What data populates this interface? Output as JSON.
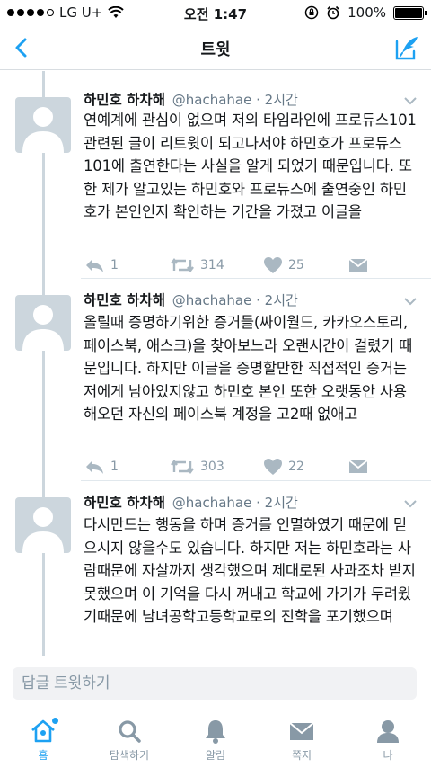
{
  "status": {
    "carrier": "LG U+",
    "time": "오전 1:47",
    "battery": "100%",
    "battery_level": 1.0,
    "signal_bars_filled": 4
  },
  "nav": {
    "title": "트윗"
  },
  "tweets": [
    {
      "name": "하민호 하차해",
      "handle": "@hachahae",
      "time": "· 2시간",
      "text": "연예계에 관심이 없으며 저의 타임라인에 프로듀스101 관련된 글이 리트윗이 되고나서야 하민호가 프로듀스101에 출연한다는 사실을 알게 되었기 때문입니다. 또한 제가 알고있는 하민호와 프로듀스에 출연중인 하민호가 본인인지 확인하는 기간을 가졌고 이글을",
      "replies": "1",
      "retweets": "314",
      "likes": "25"
    },
    {
      "name": "하민호 하차해",
      "handle": "@hachahae",
      "time": "· 2시간",
      "text": "올릴때 증명하기위한 증거들(싸이월드, 카카오스토리, 페이스북, 애스크)을 찾아보느라 오랜시간이 걸렸기 때문입니다. 하지만 이글을 증명할만한 직접적인 증거는 저에게 남아있지않고 하민호 본인 또한 오랫동안 사용해오던 자신의 페이스북 계정을 고2때 없애고",
      "replies": "1",
      "retweets": "303",
      "likes": "22"
    },
    {
      "name": "하민호 하차해",
      "handle": "@hachahae",
      "time": "· 2시간",
      "text": "다시만드는 행동을 하며 증거를 인멸하였기 때문에 믿으시지 않을수도 있습니다. 하지만 저는 하민호라는 사람때문에 자살까지 생각했으며 제대로된 사과조차 받지 못했으며 이 기억을 다시 꺼내고 학교에 가기가 두려웠기때문에 남녀공학고등학교로의 진학을 포기했으며"
    }
  ],
  "reply": {
    "placeholder": "답글 트윗하기"
  },
  "tabs": [
    {
      "label": "홈",
      "icon": "home-icon"
    },
    {
      "label": "탐색하기",
      "icon": "search-icon"
    },
    {
      "label": "알림",
      "icon": "bell-icon"
    },
    {
      "label": "쪽지",
      "icon": "envelope-icon"
    },
    {
      "label": "나",
      "icon": "person-icon"
    }
  ],
  "colors": {
    "accent": "#1da1f2",
    "muted": "#8899a6",
    "divider": "#e1e8ed"
  }
}
